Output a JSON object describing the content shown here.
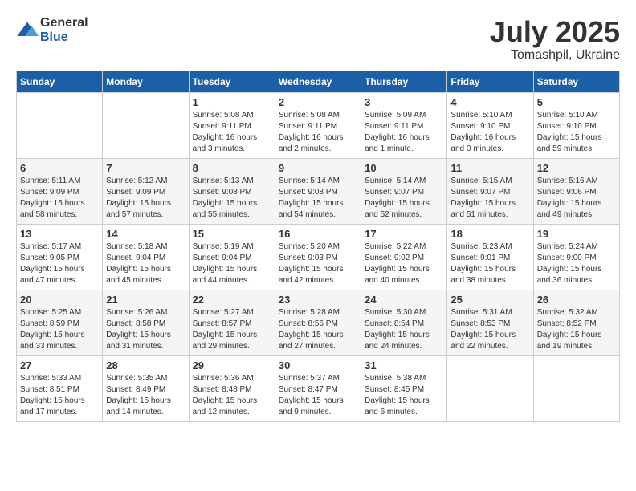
{
  "header": {
    "logo_general": "General",
    "logo_blue": "Blue",
    "month": "July 2025",
    "location": "Tomashpil, Ukraine"
  },
  "weekdays": [
    "Sunday",
    "Monday",
    "Tuesday",
    "Wednesday",
    "Thursday",
    "Friday",
    "Saturday"
  ],
  "weeks": [
    [
      {
        "day": "",
        "sunrise": "",
        "sunset": "",
        "daylight": ""
      },
      {
        "day": "",
        "sunrise": "",
        "sunset": "",
        "daylight": ""
      },
      {
        "day": "1",
        "sunrise": "Sunrise: 5:08 AM",
        "sunset": "Sunset: 9:11 PM",
        "daylight": "Daylight: 16 hours and 3 minutes."
      },
      {
        "day": "2",
        "sunrise": "Sunrise: 5:08 AM",
        "sunset": "Sunset: 9:11 PM",
        "daylight": "Daylight: 16 hours and 2 minutes."
      },
      {
        "day": "3",
        "sunrise": "Sunrise: 5:09 AM",
        "sunset": "Sunset: 9:11 PM",
        "daylight": "Daylight: 16 hours and 1 minute."
      },
      {
        "day": "4",
        "sunrise": "Sunrise: 5:10 AM",
        "sunset": "Sunset: 9:10 PM",
        "daylight": "Daylight: 16 hours and 0 minutes."
      },
      {
        "day": "5",
        "sunrise": "Sunrise: 5:10 AM",
        "sunset": "Sunset: 9:10 PM",
        "daylight": "Daylight: 15 hours and 59 minutes."
      }
    ],
    [
      {
        "day": "6",
        "sunrise": "Sunrise: 5:11 AM",
        "sunset": "Sunset: 9:09 PM",
        "daylight": "Daylight: 15 hours and 58 minutes."
      },
      {
        "day": "7",
        "sunrise": "Sunrise: 5:12 AM",
        "sunset": "Sunset: 9:09 PM",
        "daylight": "Daylight: 15 hours and 57 minutes."
      },
      {
        "day": "8",
        "sunrise": "Sunrise: 5:13 AM",
        "sunset": "Sunset: 9:08 PM",
        "daylight": "Daylight: 15 hours and 55 minutes."
      },
      {
        "day": "9",
        "sunrise": "Sunrise: 5:14 AM",
        "sunset": "Sunset: 9:08 PM",
        "daylight": "Daylight: 15 hours and 54 minutes."
      },
      {
        "day": "10",
        "sunrise": "Sunrise: 5:14 AM",
        "sunset": "Sunset: 9:07 PM",
        "daylight": "Daylight: 15 hours and 52 minutes."
      },
      {
        "day": "11",
        "sunrise": "Sunrise: 5:15 AM",
        "sunset": "Sunset: 9:07 PM",
        "daylight": "Daylight: 15 hours and 51 minutes."
      },
      {
        "day": "12",
        "sunrise": "Sunrise: 5:16 AM",
        "sunset": "Sunset: 9:06 PM",
        "daylight": "Daylight: 15 hours and 49 minutes."
      }
    ],
    [
      {
        "day": "13",
        "sunrise": "Sunrise: 5:17 AM",
        "sunset": "Sunset: 9:05 PM",
        "daylight": "Daylight: 15 hours and 47 minutes."
      },
      {
        "day": "14",
        "sunrise": "Sunrise: 5:18 AM",
        "sunset": "Sunset: 9:04 PM",
        "daylight": "Daylight: 15 hours and 45 minutes."
      },
      {
        "day": "15",
        "sunrise": "Sunrise: 5:19 AM",
        "sunset": "Sunset: 9:04 PM",
        "daylight": "Daylight: 15 hours and 44 minutes."
      },
      {
        "day": "16",
        "sunrise": "Sunrise: 5:20 AM",
        "sunset": "Sunset: 9:03 PM",
        "daylight": "Daylight: 15 hours and 42 minutes."
      },
      {
        "day": "17",
        "sunrise": "Sunrise: 5:22 AM",
        "sunset": "Sunset: 9:02 PM",
        "daylight": "Daylight: 15 hours and 40 minutes."
      },
      {
        "day": "18",
        "sunrise": "Sunrise: 5:23 AM",
        "sunset": "Sunset: 9:01 PM",
        "daylight": "Daylight: 15 hours and 38 minutes."
      },
      {
        "day": "19",
        "sunrise": "Sunrise: 5:24 AM",
        "sunset": "Sunset: 9:00 PM",
        "daylight": "Daylight: 15 hours and 36 minutes."
      }
    ],
    [
      {
        "day": "20",
        "sunrise": "Sunrise: 5:25 AM",
        "sunset": "Sunset: 8:59 PM",
        "daylight": "Daylight: 15 hours and 33 minutes."
      },
      {
        "day": "21",
        "sunrise": "Sunrise: 5:26 AM",
        "sunset": "Sunset: 8:58 PM",
        "daylight": "Daylight: 15 hours and 31 minutes."
      },
      {
        "day": "22",
        "sunrise": "Sunrise: 5:27 AM",
        "sunset": "Sunset: 8:57 PM",
        "daylight": "Daylight: 15 hours and 29 minutes."
      },
      {
        "day": "23",
        "sunrise": "Sunrise: 5:28 AM",
        "sunset": "Sunset: 8:56 PM",
        "daylight": "Daylight: 15 hours and 27 minutes."
      },
      {
        "day": "24",
        "sunrise": "Sunrise: 5:30 AM",
        "sunset": "Sunset: 8:54 PM",
        "daylight": "Daylight: 15 hours and 24 minutes."
      },
      {
        "day": "25",
        "sunrise": "Sunrise: 5:31 AM",
        "sunset": "Sunset: 8:53 PM",
        "daylight": "Daylight: 15 hours and 22 minutes."
      },
      {
        "day": "26",
        "sunrise": "Sunrise: 5:32 AM",
        "sunset": "Sunset: 8:52 PM",
        "daylight": "Daylight: 15 hours and 19 minutes."
      }
    ],
    [
      {
        "day": "27",
        "sunrise": "Sunrise: 5:33 AM",
        "sunset": "Sunset: 8:51 PM",
        "daylight": "Daylight: 15 hours and 17 minutes."
      },
      {
        "day": "28",
        "sunrise": "Sunrise: 5:35 AM",
        "sunset": "Sunset: 8:49 PM",
        "daylight": "Daylight: 15 hours and 14 minutes."
      },
      {
        "day": "29",
        "sunrise": "Sunrise: 5:36 AM",
        "sunset": "Sunset: 8:48 PM",
        "daylight": "Daylight: 15 hours and 12 minutes."
      },
      {
        "day": "30",
        "sunrise": "Sunrise: 5:37 AM",
        "sunset": "Sunset: 8:47 PM",
        "daylight": "Daylight: 15 hours and 9 minutes."
      },
      {
        "day": "31",
        "sunrise": "Sunrise: 5:38 AM",
        "sunset": "Sunset: 8:45 PM",
        "daylight": "Daylight: 15 hours and 6 minutes."
      },
      {
        "day": "",
        "sunrise": "",
        "sunset": "",
        "daylight": ""
      },
      {
        "day": "",
        "sunrise": "",
        "sunset": "",
        "daylight": ""
      }
    ]
  ]
}
